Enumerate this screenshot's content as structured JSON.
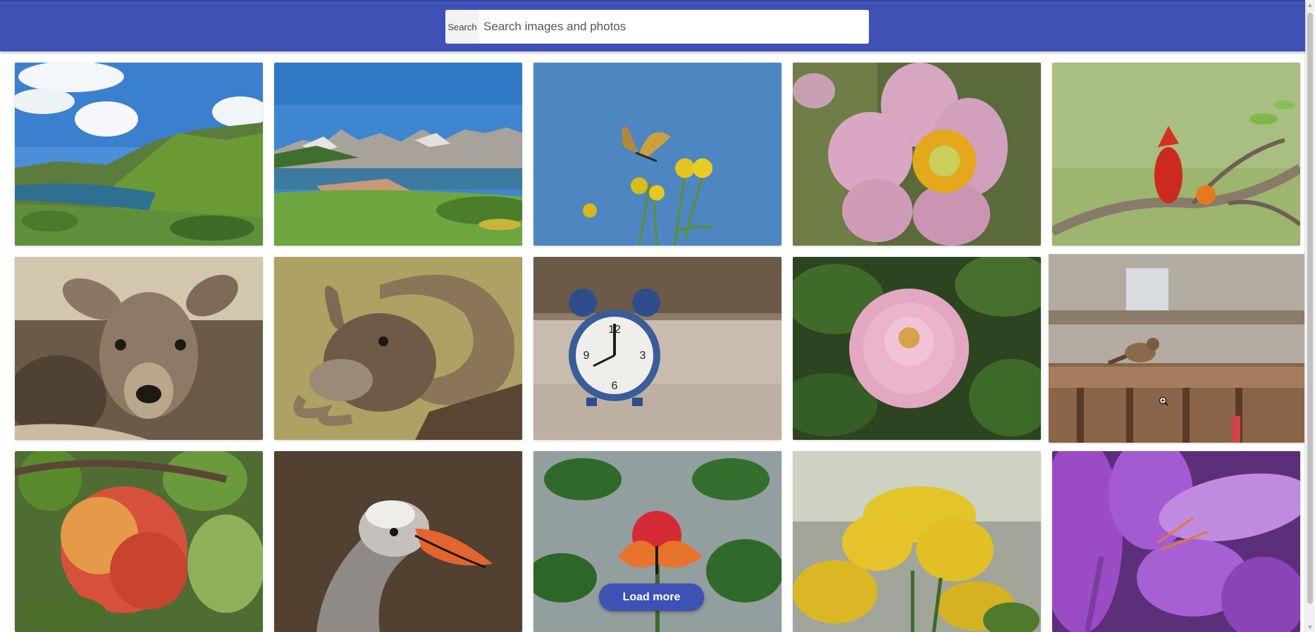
{
  "header": {
    "search_button_label": "Search",
    "search_placeholder": "Search images and photos",
    "search_value": "",
    "background_color": "#3f51b5"
  },
  "gallery": {
    "images": [
      {
        "subject": "lake-hills-landscape"
      },
      {
        "subject": "mountain-lake-village"
      },
      {
        "subject": "butterfly-yellow-flowers"
      },
      {
        "subject": "pink-anemone-flower"
      },
      {
        "subject": "red-cardinal-bird"
      },
      {
        "subject": "young-deer"
      },
      {
        "subject": "mouflon-ram"
      },
      {
        "subject": "blue-alarm-clock"
      },
      {
        "subject": "pink-dahlia"
      },
      {
        "subject": "sparrow-on-fence"
      },
      {
        "subject": "red-apple"
      },
      {
        "subject": "goose"
      },
      {
        "subject": "butterfly-red-flower"
      },
      {
        "subject": "yellow-primrose"
      },
      {
        "subject": "purple-crocus"
      }
    ]
  },
  "load_more": {
    "label": "Load more"
  }
}
